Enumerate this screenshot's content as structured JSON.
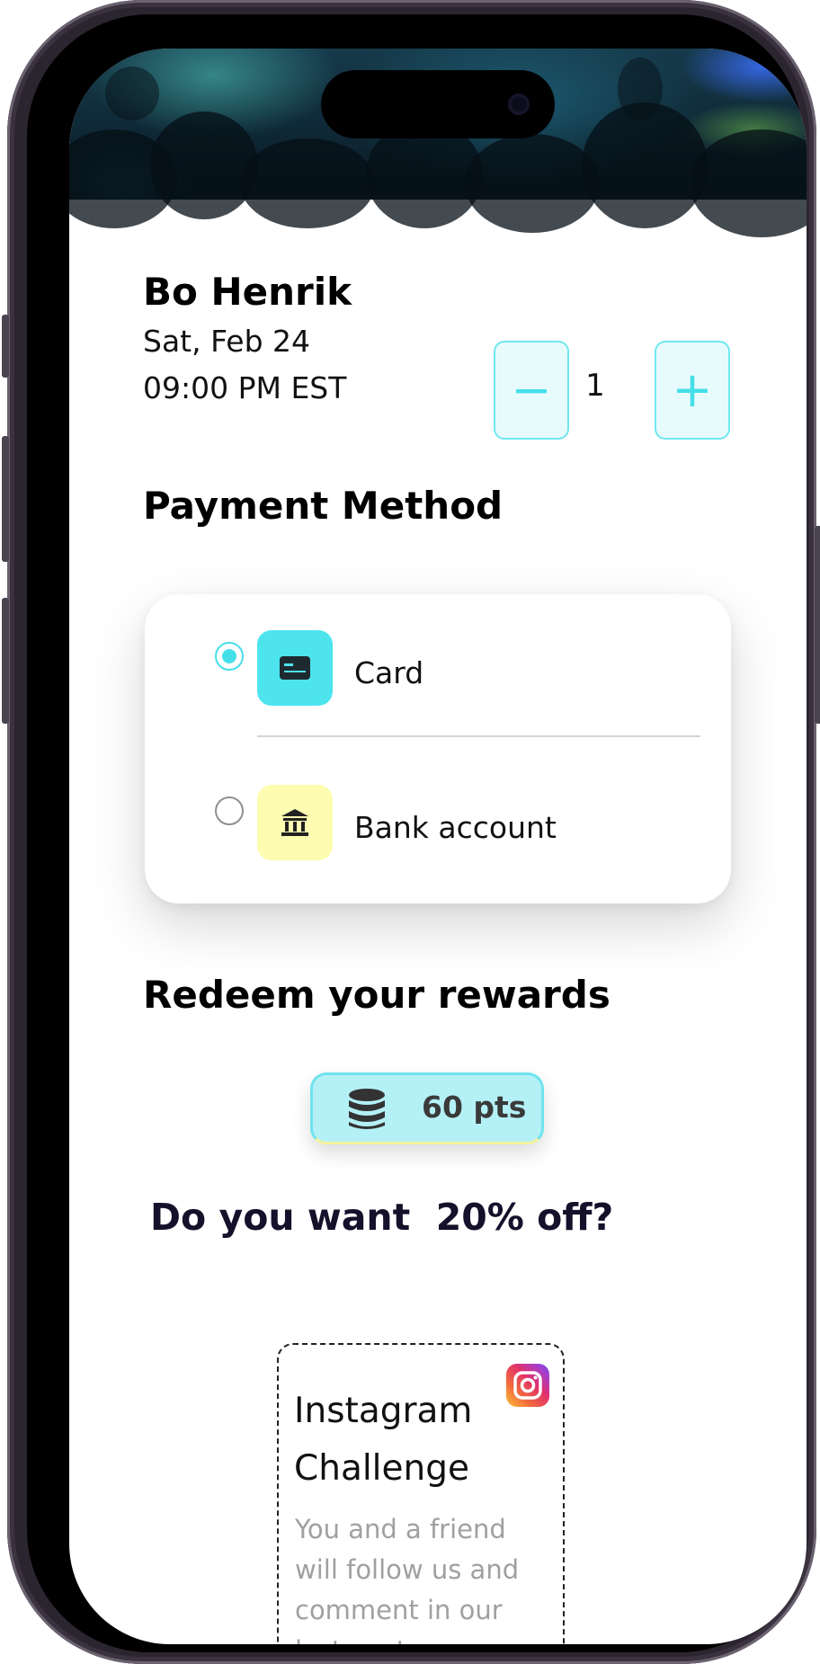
{
  "event": {
    "name": "Bo Henrik",
    "date": "Sat, Feb 24",
    "time": "09:00 PM EST"
  },
  "quantity": {
    "value": "1",
    "minus_label": "−",
    "plus_label": "+"
  },
  "payment": {
    "title": "Payment Method",
    "options": [
      {
        "label": "Card",
        "selected": true,
        "icon": "credit-card-icon",
        "color": "#4de4ee"
      },
      {
        "label": "Bank account",
        "selected": false,
        "icon": "bank-icon",
        "color": "#fdfcb0"
      }
    ]
  },
  "rewards": {
    "title": "Redeem your rewards",
    "points": "60 pts",
    "icon": "coins-stack-icon"
  },
  "offer": {
    "title": "Do you want  20% off?"
  },
  "challenge": {
    "title": "Instagram Challenge",
    "description": "You and a friend will follow us and comment in our last post",
    "icon": "instagram-icon"
  },
  "colors": {
    "accent": "#45dfe8",
    "accent_light": "#e7fbfd",
    "bank_yellow": "#fdfcb0"
  }
}
